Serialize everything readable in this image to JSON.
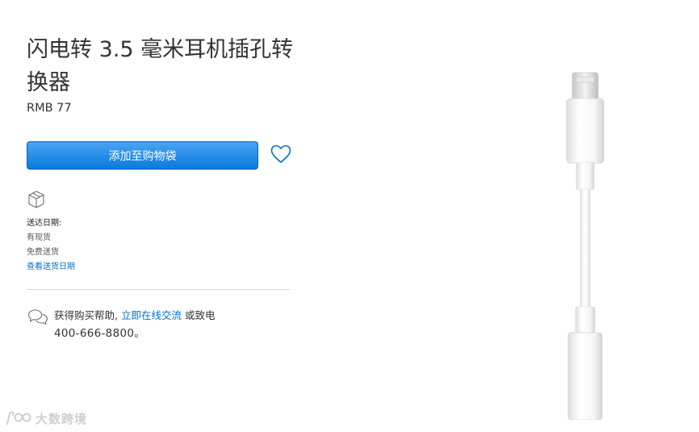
{
  "product": {
    "title": "闪电转 3.5 毫米耳机插孔转换器",
    "price": "RMB 77"
  },
  "actions": {
    "add_to_bag_label": "添加至购物袋"
  },
  "delivery": {
    "label": "送达日期:",
    "stock_status": "有现货",
    "shipping": "免费送货",
    "view_dates_link": "查看送货日期"
  },
  "help": {
    "prefix": "获得购买帮助,",
    "chat_link": "立即在线交流",
    "middle": "或致电",
    "phone": "400-666-8800。"
  },
  "watermark": {
    "text": "大数跨境"
  },
  "icons": {
    "favorite": "heart-icon",
    "shipping": "box-icon",
    "help": "chat-bubbles-icon",
    "brand": "watermark-logo-icon"
  },
  "colors": {
    "button": "#0a7ae0",
    "link": "#0070c9",
    "text": "#333336"
  }
}
